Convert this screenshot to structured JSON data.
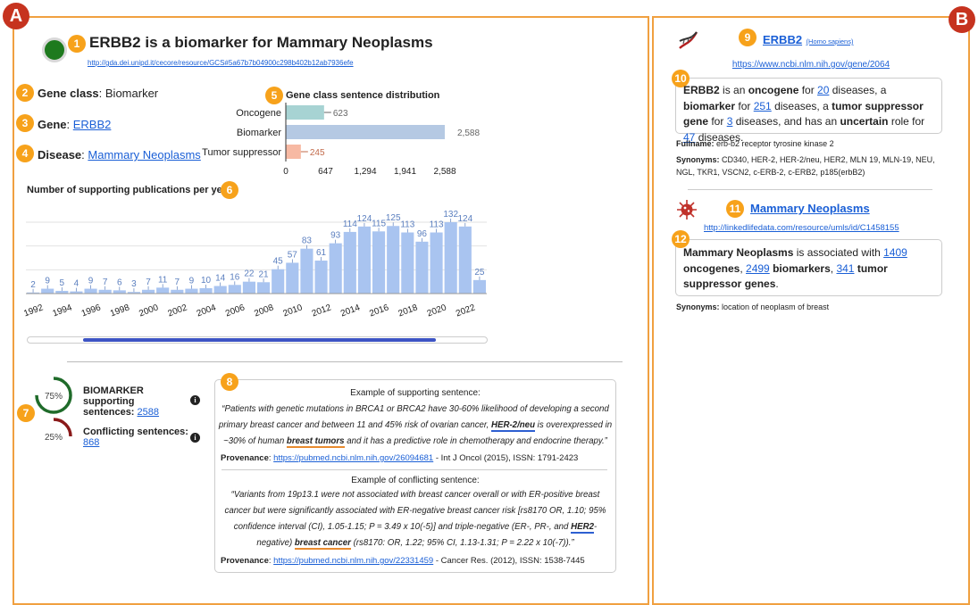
{
  "labels": {
    "a": "A",
    "b": "B"
  },
  "badges": [
    "1",
    "2",
    "3",
    "4",
    "5",
    "6",
    "7",
    "8",
    "9",
    "10",
    "11",
    "12"
  ],
  "left": {
    "title": "ERBB2 is a biomarker for Mammary Neoplasms",
    "url": "http://gda.dei.unipd.it/cecore/resource/GCS#5a67b7b04900c298b402b12ab7936efe",
    "gene_class_label": "Gene class",
    "gene_class_value": "Biomarker",
    "gene_label": "Gene",
    "gene_value": "ERBB2",
    "disease_label": "Disease",
    "disease_value": "Mammary Neoplasms",
    "pub_title": "Number of supporting publications per year"
  },
  "chart_data": [
    {
      "type": "bar",
      "title": "Gene class sentence distribution",
      "categories": [
        "Oncogene",
        "Biomarker",
        "Tumor suppressor"
      ],
      "values": [
        623,
        2588,
        245
      ],
      "value_labels": [
        "623",
        "2,588",
        "245"
      ],
      "xticks": [
        "0",
        "647",
        "1,294",
        "1,941",
        "2,588"
      ],
      "xlim": [
        0,
        2588
      ],
      "colors": [
        "#a7d3d3",
        "#b5c9e3",
        "#f7b9a3"
      ],
      "label_colors": [
        "#666",
        "#666",
        "#c26a4a"
      ]
    },
    {
      "type": "bar",
      "title": "Number of supporting publications per year",
      "categories": [
        "1992",
        "1993",
        "1994",
        "1995",
        "1996",
        "1997",
        "1998",
        "1999",
        "2000",
        "2001",
        "2002",
        "2003",
        "2004",
        "2005",
        "2006",
        "2007",
        "2008",
        "2009",
        "2010",
        "2011",
        "2012",
        "2013",
        "2014",
        "2015",
        "2016",
        "2017",
        "2018",
        "2019",
        "2020",
        "2021",
        "2022"
      ],
      "values": [
        2,
        9,
        5,
        4,
        9,
        7,
        6,
        3,
        7,
        11,
        7,
        9,
        10,
        14,
        16,
        22,
        21,
        45,
        57,
        83,
        61,
        93,
        114,
        124,
        115,
        125,
        113,
        96,
        113,
        132,
        124,
        25
      ],
      "tick_labels": [
        "1992",
        "1994",
        "1996",
        "1998",
        "2000",
        "2002",
        "2004",
        "2006",
        "2008",
        "2010",
        "2012",
        "2014",
        "2016",
        "2018",
        "2020",
        "2022"
      ],
      "color": "#a9c4f0",
      "label_color": "#5b7fbf"
    }
  ],
  "scrollbar": {
    "progress": 0.87
  },
  "gauges": {
    "biomarker_pct": "75%",
    "biomarker_fraction": 0.75,
    "biomarker_label": "BIOMARKER supporting sentences:",
    "biomarker_count": "2588",
    "conflict_pct": "25%",
    "conflict_fraction": 0.25,
    "conflict_label": "Conflicting sentences:",
    "conflict_count": "868",
    "info": "i"
  },
  "support": {
    "heading": "Example of supporting sentence:",
    "t1": "“Patients with genetic mutations in BRCA1 or BRCA2 have 30-60% likelihood of developing a second primary breast cancer and between 11 and 45% risk of ovarian cancer, ",
    "hl1": "HER-2/neu",
    "t2": " is overexpressed in ~30% of human ",
    "hl2": "breast tumors",
    "t3": " and it has a predictive role in chemotherapy and endocrine therapy.”",
    "prov_label": "Provenance",
    "prov_url": "https://pubmed.ncbi.nlm.nih.gov/26094681",
    "prov_rest": " - Int J Oncol (2015), ISSN: 1791-2423"
  },
  "conflict": {
    "heading": "Example of conflicting sentence:",
    "t1": "“Variants from 19p13.1 were not associated with breast cancer overall or with ER-positive breast cancer but were significantly associated with ER-negative breast cancer risk [rs8170 OR, 1.10; 95% confidence interval (CI), 1.05-1.15; P = 3.49 x 10(-5)] and triple-negative (ER-, PR-, and ",
    "hl1": "HER2",
    "t2": "-negative) ",
    "hl2": "breast cancer",
    "t3": " (rs8170: OR, 1.22; 95% CI, 1.13-1.31; P = 2.22 x 10(-7)).”",
    "prov_label": "Provenance",
    "prov_url": "https://pubmed.ncbi.nlm.nih.gov/22331459",
    "prov_rest": " - Cancer Res. (2012), ISSN: 1538-7445"
  },
  "right": {
    "gene_name": "ERBB2",
    "species": "(Homo sapiens)",
    "gene_url": "https://www.ncbi.nlm.nih.gov/gene/2064",
    "g_t1": " is an ",
    "g_b1": "oncogene",
    "g_t2": " for ",
    "g_n1": "20",
    "g_t3": " diseases, a ",
    "g_b2": "biomarker",
    "g_t4": " for ",
    "g_n2": "251",
    "g_t5": " diseases, a ",
    "g_b3": "tumor suppressor gene",
    "g_t6": " for ",
    "g_n3": "3",
    "g_t7": " diseases, and has an ",
    "g_b4": "uncertain",
    "g_t8": " role for ",
    "g_n4": "47",
    "g_t9": " diseases.",
    "fullname_label": "Fullname:",
    "fullname": " erb-b2 receptor tyrosine kinase 2",
    "synonyms_label": "Synonyms:",
    "synonyms": " CD340, HER-2, HER-2/neu, HER2, MLN 19, MLN-19, NEU, NGL, TKR1, VSCN2, c-ERB-2, c-ERB2, p185(erbB2)",
    "disease_name": "Mammary Neoplasms",
    "disease_url": "http://linkedlifedata.com/resource/umls/id/C1458155",
    "d_t1": " is associated with ",
    "d_n1": "1409",
    "d_b1": "oncogenes",
    "d_n2": "2499",
    "d_b2": "biomarkers",
    "d_n3": "341",
    "d_b3": "tumor suppressor genes",
    "d_syn_label": "Synonyms:",
    "d_syn": " location of neoplasm of breast"
  }
}
